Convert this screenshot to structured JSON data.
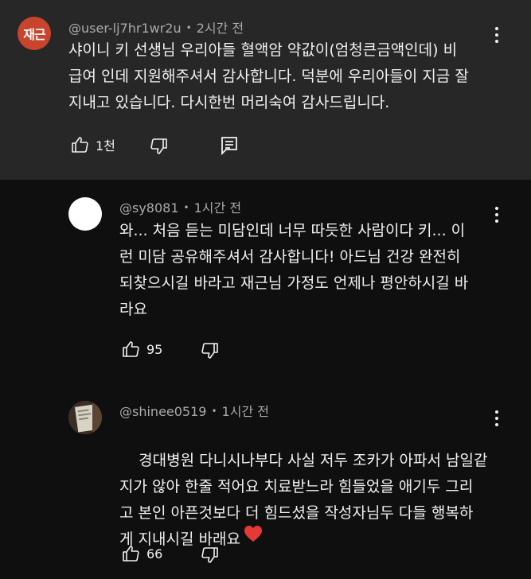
{
  "comments": [
    {
      "avatar_text": "재근",
      "avatar_color": "#c8442c",
      "author": "@user-lj7hr1wr2u",
      "time": "2시간 전",
      "text": "샤이니 키 선생님 우리아들 혈액암 약값이(엄청큰금액인데) 비\n급여 인데 지원해주셔서 감사합니다. 덕분에 우리아들이 지금 잘\n지내고 있습니다. 다시한번 머리숙여 감사드립니다.",
      "likes": "1천"
    },
    {
      "avatar_color": "#ffffff",
      "author": "@sy8081",
      "time": "1시간 전",
      "text": "와... 처음 듣는 미담인데 너무 따듯한 사람이다 키... 이\n런 미담 공유해주셔서 감사합니다! 아드님 건강 완전히\n되찾으시길 바라고 재근님 가정도 언제나 평안하시길 바\n라요",
      "likes": "95"
    },
    {
      "author": "@shinee0519",
      "time": "1시간 전",
      "text": "경대병원 다니시나부다 사실 저두 조카가 아파서 남일같\n지가 않아 한줄 적어요 치료받느라 힘들었을 애기두 그리\n고 본인 아픈것보다 더 힘드셨을 작성자님두 다들 행복하\n게 지내시길 바래요",
      "likes": "66"
    }
  ]
}
